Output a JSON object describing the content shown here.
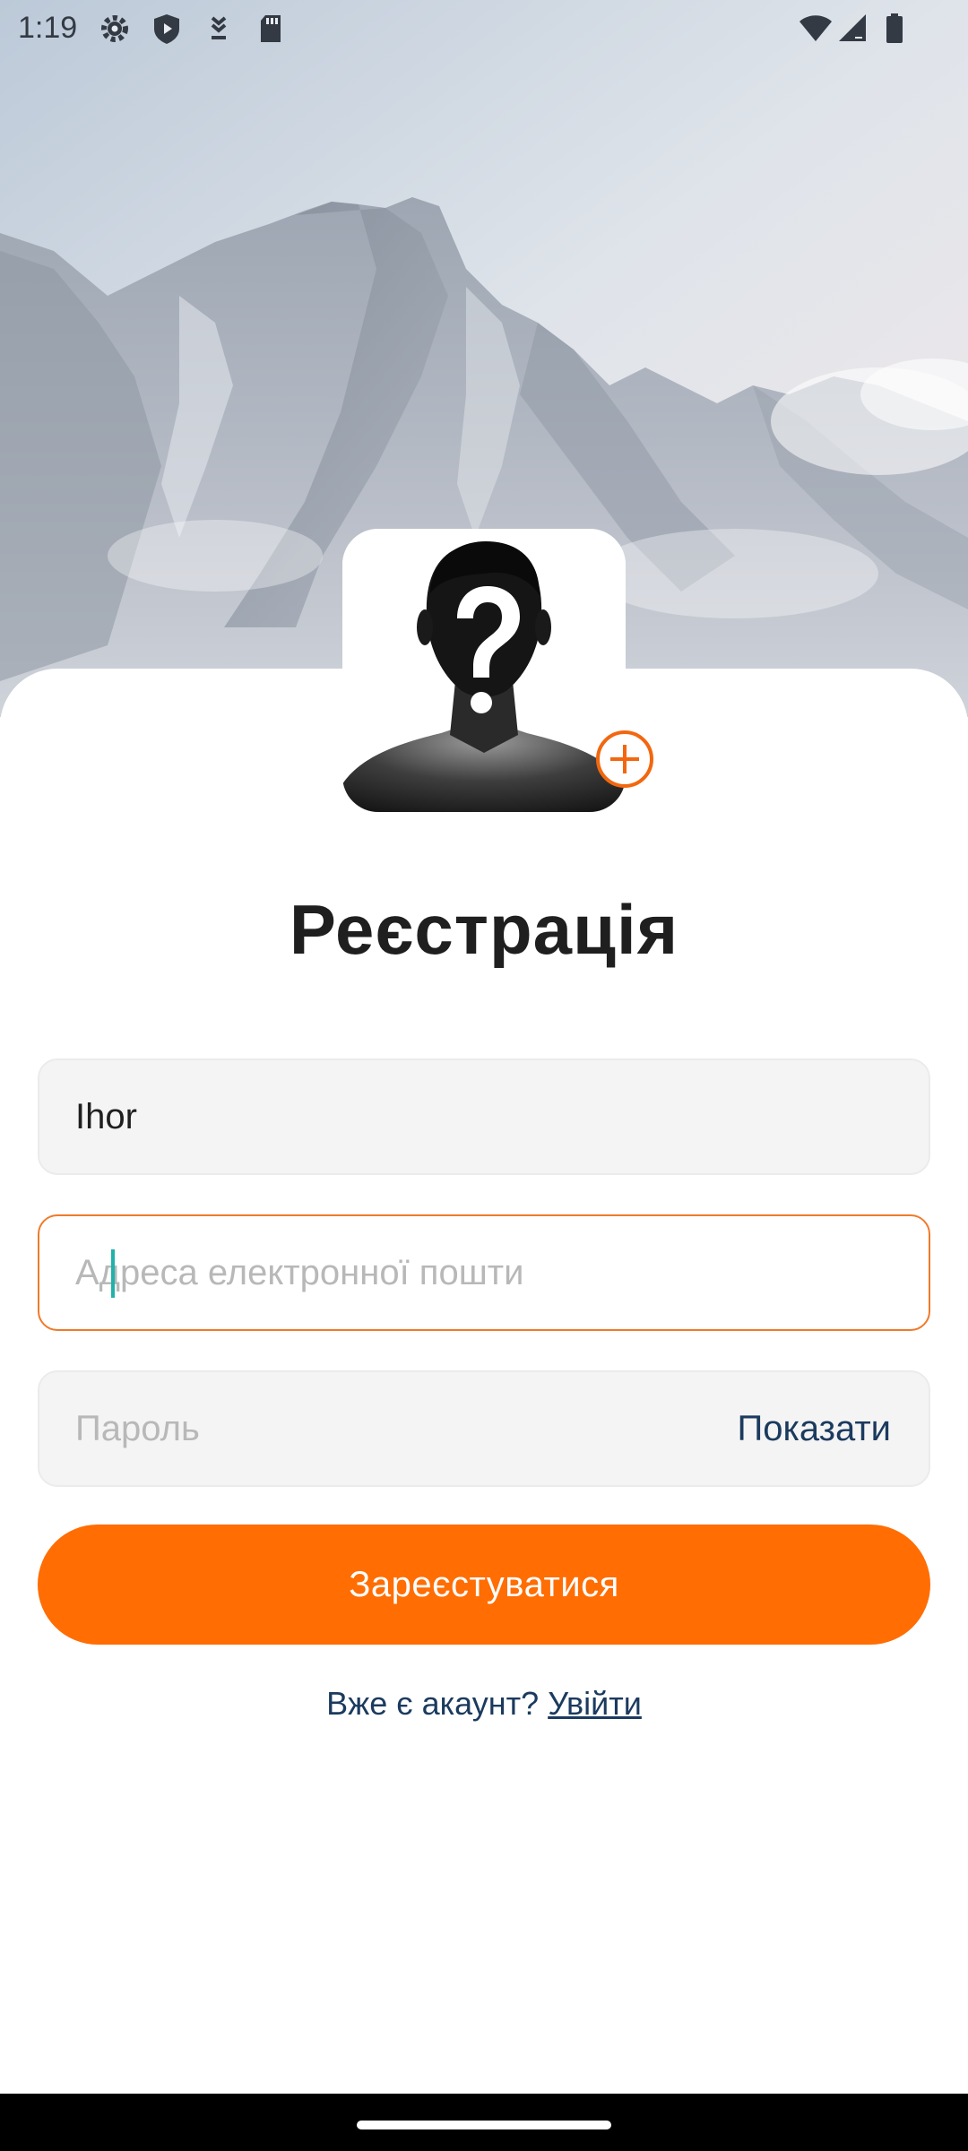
{
  "status_bar": {
    "time": "1:19",
    "icons": [
      "settings-icon",
      "shield-icon",
      "download-icon",
      "sd-card-icon",
      "wifi-icon",
      "signal-icon",
      "battery-icon"
    ]
  },
  "avatar": {
    "icon": "unknown-person-icon",
    "add_icon": "add-circle-icon"
  },
  "title": "Реєстрація",
  "form": {
    "name_value": "Ihor",
    "email_placeholder": "Адреса електронної пошти",
    "password_placeholder": "Пароль",
    "show_password_label": "Показати",
    "submit_label": "Зареєстуватися"
  },
  "login_prompt": {
    "question": "Вже є акаунт? ",
    "link": "Увійти"
  },
  "colors": {
    "accent": "#ff6d03",
    "focus_border": "#f07a2a",
    "link": "#1b3a5e",
    "caret": "#20b2aa"
  }
}
